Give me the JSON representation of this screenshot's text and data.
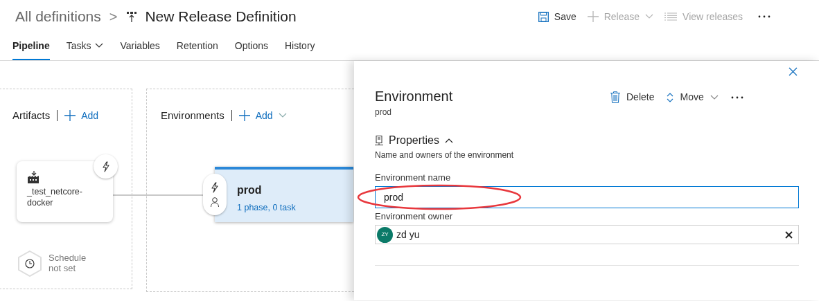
{
  "breadcrumb": {
    "parent": "All definitions",
    "separator": ">",
    "title": "New Release Definition"
  },
  "toolbar": [
    {
      "kind": "save",
      "label": "Save",
      "disabled": false,
      "dropdown": false
    },
    {
      "kind": "release",
      "label": "Release",
      "disabled": true,
      "dropdown": true
    },
    {
      "kind": "list",
      "label": "View releases",
      "disabled": true,
      "dropdown": false
    }
  ],
  "tabs": [
    {
      "label": "Pipeline",
      "selected": true,
      "dropdown": false
    },
    {
      "label": "Tasks",
      "selected": false,
      "dropdown": true
    },
    {
      "label": "Variables",
      "selected": false,
      "dropdown": false
    },
    {
      "label": "Retention",
      "selected": false,
      "dropdown": false
    },
    {
      "label": "Options",
      "selected": false,
      "dropdown": false
    },
    {
      "label": "History",
      "selected": false,
      "dropdown": false
    }
  ],
  "artifacts": {
    "title": "Artifacts",
    "add_label": "Add",
    "artifact": {
      "name": "_test_netcore-docker"
    },
    "schedule": "Schedule not set"
  },
  "environments": {
    "title": "Environments",
    "add_label": "Add",
    "card": {
      "name": "prod",
      "summary": "1 phase, 0 task",
      "selected": true
    }
  },
  "panel": {
    "title": "Environment",
    "subtitle": "prod",
    "actions": [
      {
        "kind": "delete",
        "label": "Delete"
      },
      {
        "kind": "move",
        "label": "Move"
      }
    ],
    "section": {
      "title": "Properties",
      "expanded": true,
      "description": "Name and owners of the environment"
    },
    "name_field": {
      "label": "Environment name",
      "value": "prod"
    },
    "owner_field": {
      "label": "Environment owner",
      "initials": "ZY",
      "value": "zd yu"
    }
  }
}
